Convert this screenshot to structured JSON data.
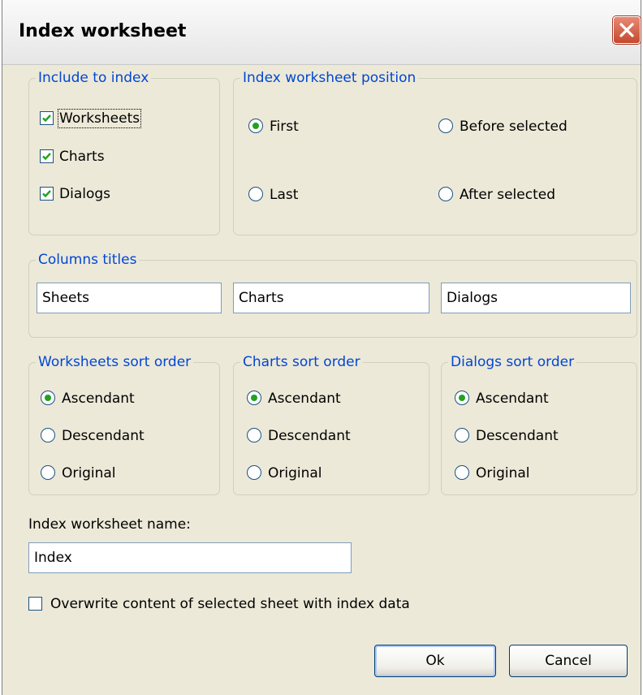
{
  "window": {
    "title": "Index worksheet"
  },
  "include": {
    "legend": "Include to index",
    "items": [
      {
        "label": "Worksheets",
        "checked": true
      },
      {
        "label": "Charts",
        "checked": true
      },
      {
        "label": "Dialogs",
        "checked": true
      }
    ]
  },
  "position": {
    "legend": "Index worksheet position",
    "options": [
      {
        "label": "First",
        "selected": true
      },
      {
        "label": "Before selected",
        "selected": false
      },
      {
        "label": "Last",
        "selected": false
      },
      {
        "label": "After selected",
        "selected": false
      }
    ]
  },
  "columns": {
    "legend": "Columns titles",
    "sheets_value": "Sheets",
    "charts_value": "Charts",
    "dialogs_value": "Dialogs"
  },
  "sort": {
    "worksheets": {
      "legend": "Worksheets sort order",
      "options": [
        "Ascendant",
        "Descendant",
        "Original"
      ],
      "selected": "Ascendant"
    },
    "charts": {
      "legend": "Charts sort order",
      "options": [
        "Ascendant",
        "Descendant",
        "Original"
      ],
      "selected": "Ascendant"
    },
    "dialogs": {
      "legend": "Dialogs sort order",
      "options": [
        "Ascendant",
        "Descendant",
        "Original"
      ],
      "selected": "Ascendant"
    }
  },
  "name": {
    "label": "Index worksheet name:",
    "value": "Index"
  },
  "overwrite": {
    "label": "Overwrite content of selected sheet with index data",
    "checked": false
  },
  "buttons": {
    "ok": "Ok",
    "cancel": "Cancel"
  }
}
